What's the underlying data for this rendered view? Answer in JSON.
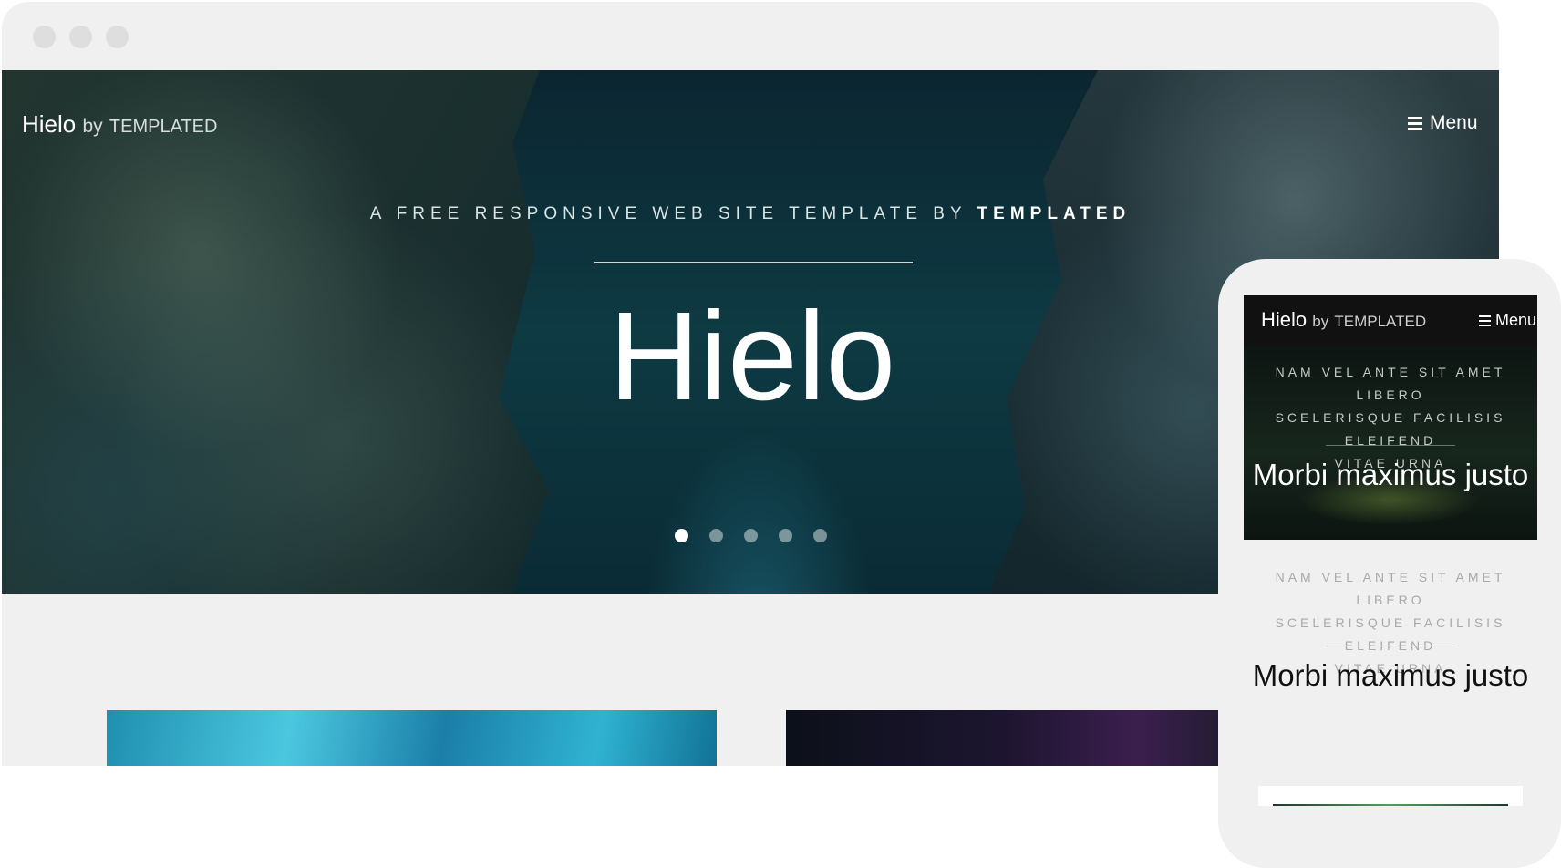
{
  "desktop": {
    "brand": {
      "name": "Hielo",
      "by": "by",
      "templated": "TEMPLATED"
    },
    "menu_label": "Menu",
    "hero": {
      "tagline_prefix": "A FREE RESPONSIVE WEB SITE TEMPLATE BY",
      "tagline_strong": "TEMPLATED",
      "title": "Hielo",
      "slide_count": 5,
      "active_slide": 1
    }
  },
  "mobile": {
    "brand": {
      "name": "Hielo",
      "by": "by",
      "templated": "TEMPLATED"
    },
    "menu_label": "Menu",
    "hero": {
      "subtitle_lines": [
        "NAM VEL ANTE SIT AMET LIBERO",
        "SCELERISQUE FACILISIS ELEIFEND",
        "VITAE URNA"
      ],
      "title": "Morbi maximus justo"
    },
    "section": {
      "subtitle_lines": [
        "NAM VEL ANTE SIT AMET LIBERO",
        "SCELERISQUE FACILISIS ELEIFEND",
        "VITAE URNA"
      ],
      "title": "Morbi maximus justo"
    }
  }
}
